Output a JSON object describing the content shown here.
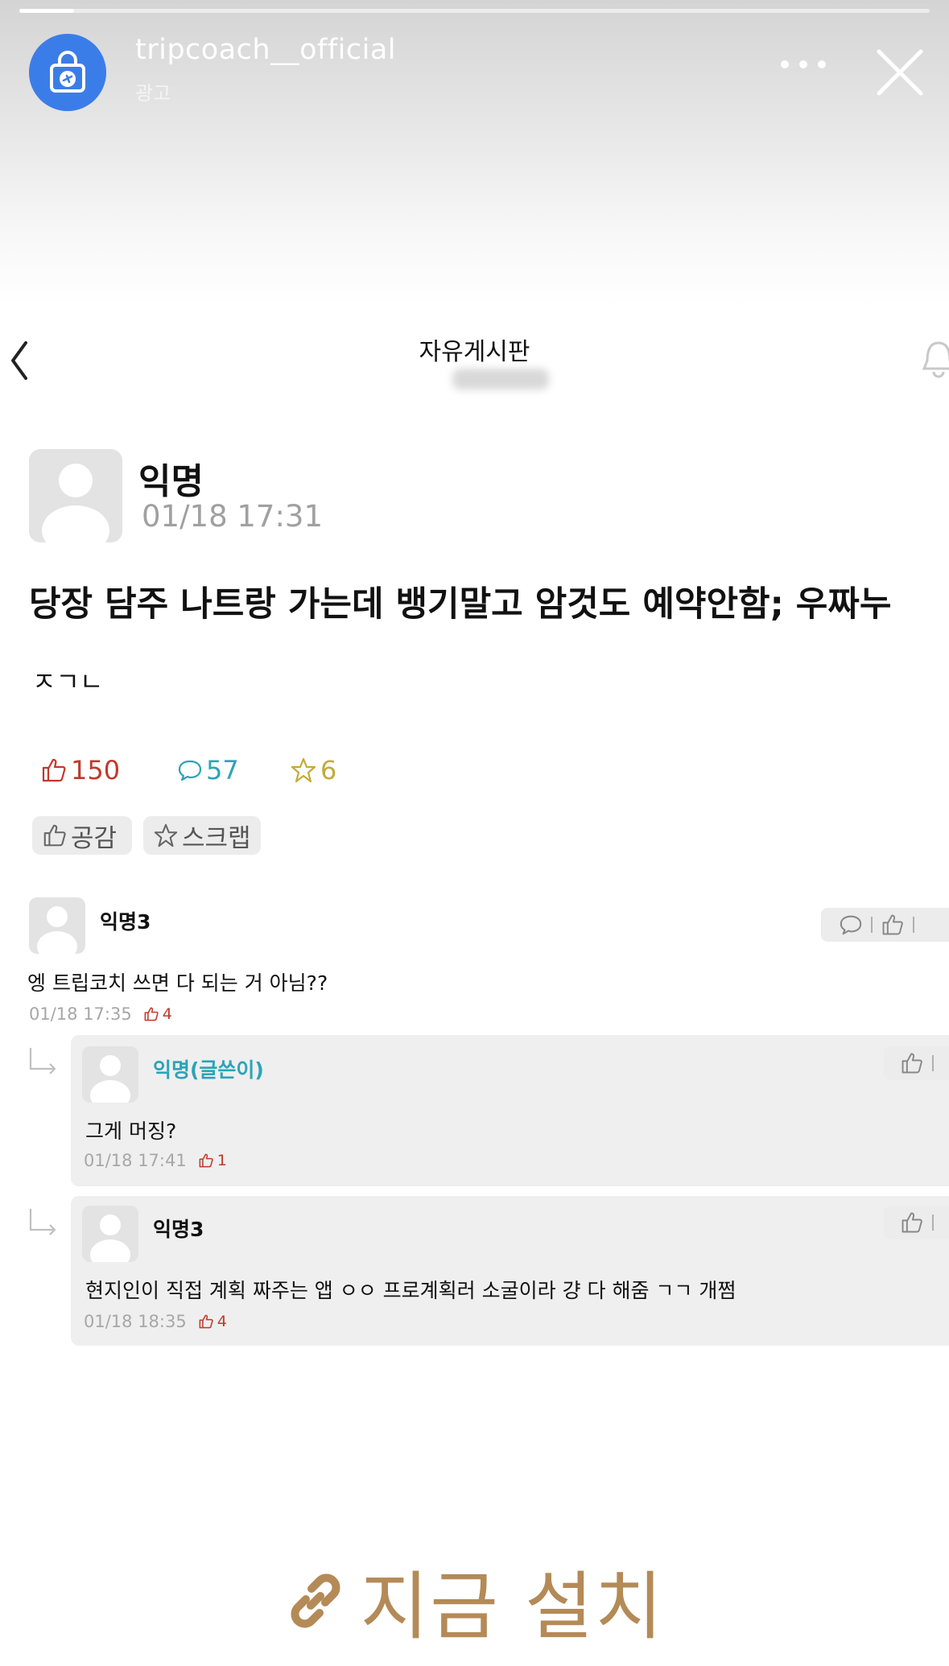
{
  "story": {
    "account_name": "tripcoach__official",
    "ad_label": "광고",
    "progress": 0.06
  },
  "board": {
    "title": "자유게시판"
  },
  "post": {
    "author": "익명",
    "time": "01/18 17:31",
    "title": "당장 담주 나트랑 가는데 뱅기말고 암것도 예약안함; 우짜누",
    "body": "ㅈㄱㄴ",
    "likes": "150",
    "comments": "57",
    "scraps": "6",
    "like_button": "공감",
    "scrap_button": "스크랩"
  },
  "comments": [
    {
      "author": "익명3",
      "text": "엥 트립코치 쓰면 다 되는 거 아님??",
      "time": "01/18 17:35",
      "votes": "4"
    },
    {
      "author": "익명(글쓴이)",
      "text": "그게 머징?",
      "time": "01/18 17:41",
      "votes": "1"
    },
    {
      "author": "익명3",
      "text": "현지인이 직접 계획 짜주는 앱 ㅇㅇ 프로계획러 소굴이라 걍 다 해줌 ㄱㄱ 개쩜",
      "time": "01/18 18:35",
      "votes": "4"
    }
  ],
  "cta": {
    "label": "지금 설치"
  },
  "colors": {
    "brand_blue": "#3b7de8",
    "like_red": "#c0392b",
    "comment_teal": "#2aa4b8",
    "scrap_gold": "#c3ab3a",
    "cta_brown": "#b48a57"
  }
}
